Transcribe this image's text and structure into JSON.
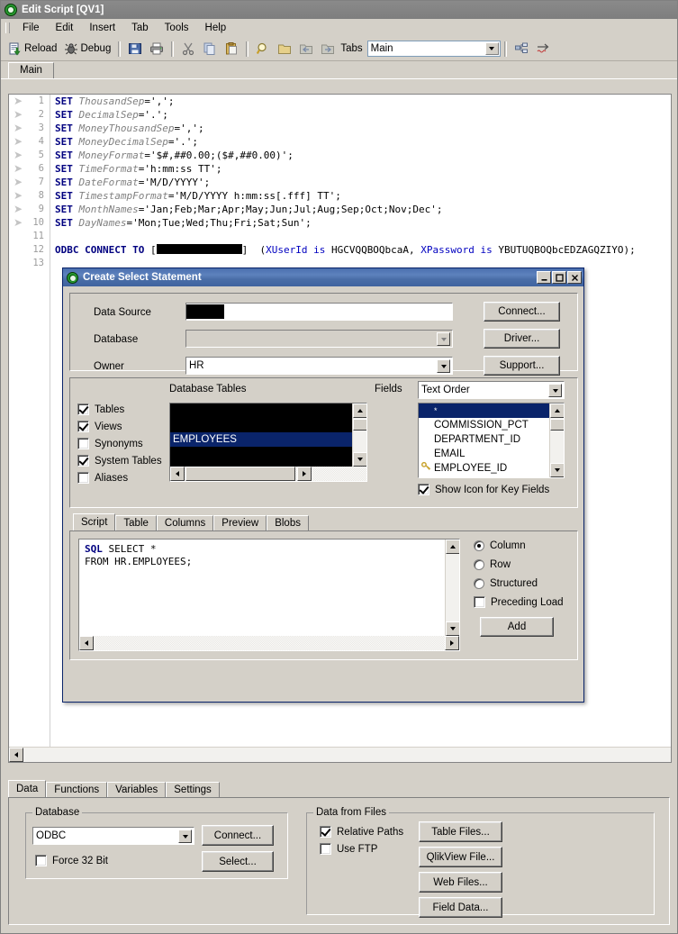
{
  "window": {
    "title": "Edit Script [QV1]",
    "logo_icon": "qlikview-logo-icon"
  },
  "menu": {
    "items": [
      "File",
      "Edit",
      "Insert",
      "Tab",
      "Tools",
      "Help"
    ]
  },
  "toolbar": {
    "reload_label": "Reload",
    "debug_label": "Debug",
    "tabs_label": "Tabs",
    "tab_selected": "Main",
    "icons": {
      "reload": "reload-icon",
      "debug": "debug-bug-icon",
      "save": "save-icon",
      "print": "print-icon",
      "cut": "cut-icon",
      "copy": "copy-icon",
      "paste": "paste-icon",
      "find": "find-magnifier-icon",
      "folder": "folder-icon",
      "undo": "undo-icon",
      "redo": "redo-icon",
      "structure": "structure-icon",
      "syntax": "syntax-icon"
    }
  },
  "script_tabs": {
    "items": [
      "Main"
    ],
    "active": "Main"
  },
  "editor": {
    "lines": [
      {
        "n": "1",
        "segments": [
          {
            "t": "SET ",
            "c": "kw"
          },
          {
            "t": "ThousandSep",
            "c": "var"
          },
          {
            "t": "=',';",
            "c": "str"
          }
        ]
      },
      {
        "n": "2",
        "segments": [
          {
            "t": "SET ",
            "c": "kw"
          },
          {
            "t": "DecimalSep",
            "c": "var"
          },
          {
            "t": "='.';",
            "c": "str"
          }
        ]
      },
      {
        "n": "3",
        "segments": [
          {
            "t": "SET ",
            "c": "kw"
          },
          {
            "t": "MoneyThousandSep",
            "c": "var"
          },
          {
            "t": "=',';",
            "c": "str"
          }
        ]
      },
      {
        "n": "4",
        "segments": [
          {
            "t": "SET ",
            "c": "kw"
          },
          {
            "t": "MoneyDecimalSep",
            "c": "var"
          },
          {
            "t": "='.';",
            "c": "str"
          }
        ]
      },
      {
        "n": "5",
        "segments": [
          {
            "t": "SET ",
            "c": "kw"
          },
          {
            "t": "MoneyFormat",
            "c": "var"
          },
          {
            "t": "='$#,##0.00;($#,##0.00)';",
            "c": "str"
          }
        ]
      },
      {
        "n": "6",
        "segments": [
          {
            "t": "SET ",
            "c": "kw"
          },
          {
            "t": "TimeFormat",
            "c": "var"
          },
          {
            "t": "='h:mm:ss TT';",
            "c": "str"
          }
        ]
      },
      {
        "n": "7",
        "segments": [
          {
            "t": "SET ",
            "c": "kw"
          },
          {
            "t": "DateFormat",
            "c": "var"
          },
          {
            "t": "='M/D/YYYY';",
            "c": "str"
          }
        ]
      },
      {
        "n": "8",
        "segments": [
          {
            "t": "SET ",
            "c": "kw"
          },
          {
            "t": "TimestampFormat",
            "c": "var"
          },
          {
            "t": "='M/D/YYYY h:mm:ss[.fff] TT';",
            "c": "str"
          }
        ]
      },
      {
        "n": "9",
        "segments": [
          {
            "t": "SET ",
            "c": "kw"
          },
          {
            "t": "MonthNames",
            "c": "var"
          },
          {
            "t": "='Jan;Feb;Mar;Apr;May;Jun;Jul;Aug;Sep;Oct;Nov;Dec';",
            "c": "str"
          }
        ]
      },
      {
        "n": "10",
        "segments": [
          {
            "t": "SET ",
            "c": "kw"
          },
          {
            "t": "DayNames",
            "c": "var"
          },
          {
            "t": "='Mon;Tue;Wed;Thu;Fri;Sat;Sun';",
            "c": "str"
          }
        ]
      },
      {
        "n": "11",
        "segments": []
      },
      {
        "n": "12",
        "segments": [
          {
            "t": "ODBC CONNECT TO ",
            "c": "kw"
          },
          {
            "t": "[",
            "c": "str"
          },
          {
            "t": "REDACTED",
            "c": "redact"
          },
          {
            "t": "]  (",
            "c": "str"
          },
          {
            "t": "XUserId is ",
            "c": "blue"
          },
          {
            "t": "HGCVQQBOQbcaA, ",
            "c": "str"
          },
          {
            "t": "XPassword is ",
            "c": "blue"
          },
          {
            "t": "YBUTUQBOQbcEDZAGQZIYO);",
            "c": "str"
          }
        ]
      },
      {
        "n": "13",
        "segments": []
      }
    ]
  },
  "dialog": {
    "title": "Create Select Statement",
    "caption_buttons": [
      "minimize",
      "maximize",
      "close"
    ],
    "connection": {
      "data_source_label": "Data Source",
      "data_source_value": "",
      "database_label": "Database",
      "database_value": "",
      "owner_label": "Owner",
      "owner_value": "HR",
      "connect_button": "Connect...",
      "driver_button": "Driver...",
      "support_button": "Support..."
    },
    "tables_panel": {
      "heading": "Database Tables",
      "filters": [
        {
          "label": "Tables",
          "checked": true
        },
        {
          "label": "Views",
          "checked": true
        },
        {
          "label": "Synonyms",
          "checked": false
        },
        {
          "label": "System Tables",
          "checked": true
        },
        {
          "label": "Aliases",
          "checked": false
        }
      ],
      "items": [
        {
          "label": "",
          "redacted": true,
          "selected": false
        },
        {
          "label": "",
          "redacted": true,
          "selected": false
        },
        {
          "label": "EMPLOYEES",
          "redacted": false,
          "selected": true
        },
        {
          "label": "",
          "redacted": true,
          "selected": false
        },
        {
          "label": "",
          "redacted": true,
          "selected": false
        },
        {
          "label": "",
          "redacted": true,
          "selected": false
        }
      ]
    },
    "fields_panel": {
      "heading": "Fields",
      "order_value": "Text Order",
      "items": [
        {
          "label": "*",
          "selected": true,
          "key": false
        },
        {
          "label": "COMMISSION_PCT",
          "selected": false,
          "key": false
        },
        {
          "label": "DEPARTMENT_ID",
          "selected": false,
          "key": false
        },
        {
          "label": "EMAIL",
          "selected": false,
          "key": false
        },
        {
          "label": "EMPLOYEE_ID",
          "selected": false,
          "key": true
        }
      ],
      "show_icon_label": "Show Icon for Key Fields",
      "show_icon_checked": true,
      "key_icon": "key-icon"
    },
    "preview_tabs": {
      "items": [
        "Script",
        "Table",
        "Columns",
        "Preview",
        "Blobs"
      ],
      "active": "Script"
    },
    "sql": {
      "lines": [
        [
          {
            "t": "SQL",
            "c": "kw"
          },
          {
            "t": " SELECT *",
            "c": "str"
          }
        ],
        [
          {
            "t": "FROM HR.EMPLOYEES;",
            "c": "str"
          }
        ]
      ]
    },
    "options": {
      "radios": [
        {
          "label": "Column",
          "selected": true
        },
        {
          "label": "Row",
          "selected": false
        },
        {
          "label": "Structured",
          "selected": false
        }
      ],
      "preceding_load_label": "Preceding Load",
      "preceding_load_checked": false,
      "add_button": "Add"
    }
  },
  "bottom_panel": {
    "tabs": {
      "items": [
        "Data",
        "Functions",
        "Variables",
        "Settings"
      ],
      "active": "Data"
    },
    "database_group": {
      "label": "Database",
      "driver_value": "ODBC",
      "force32_label": "Force 32 Bit",
      "force32_checked": false,
      "connect_button": "Connect...",
      "select_button": "Select..."
    },
    "files_group": {
      "label": "Data from Files",
      "relative_paths_label": "Relative Paths",
      "relative_paths_checked": true,
      "use_ftp_label": "Use FTP",
      "use_ftp_checked": false,
      "buttons": [
        "Table Files...",
        "QlikView File...",
        "Web Files...",
        "Field Data..."
      ]
    }
  },
  "colors": {
    "face": "#d4d0c8",
    "dialog_title": "#4a6ea8",
    "selection": "#0a246a",
    "keyword": "#000080"
  }
}
